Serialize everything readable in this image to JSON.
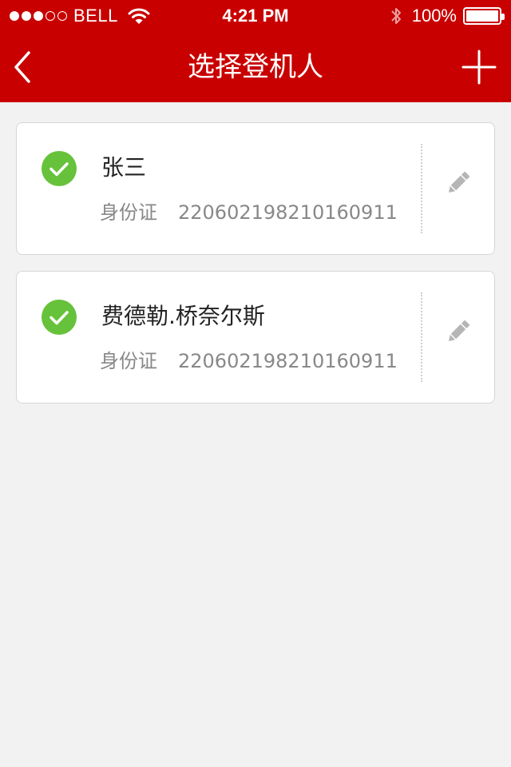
{
  "status_bar": {
    "carrier": "BELL",
    "time": "4:21 PM",
    "battery": "100%",
    "signal_bars_filled": 3,
    "signal_bars_total": 5,
    "battery_level": 1.0
  },
  "nav": {
    "title": "选择登机人",
    "back_icon": "chevron-left-icon",
    "add_icon": "plus-icon"
  },
  "colors": {
    "brand_red": "#c90000",
    "check_green": "#66c23a",
    "background": "#f2f2f2"
  },
  "passengers": [
    {
      "name": "张三",
      "id_label": "身份证",
      "id_number": "220602198210160911",
      "selected": true
    },
    {
      "name": "费德勒.桥奈尔斯",
      "id_label": "身份证",
      "id_number": "220602198210160911",
      "selected": true
    }
  ]
}
